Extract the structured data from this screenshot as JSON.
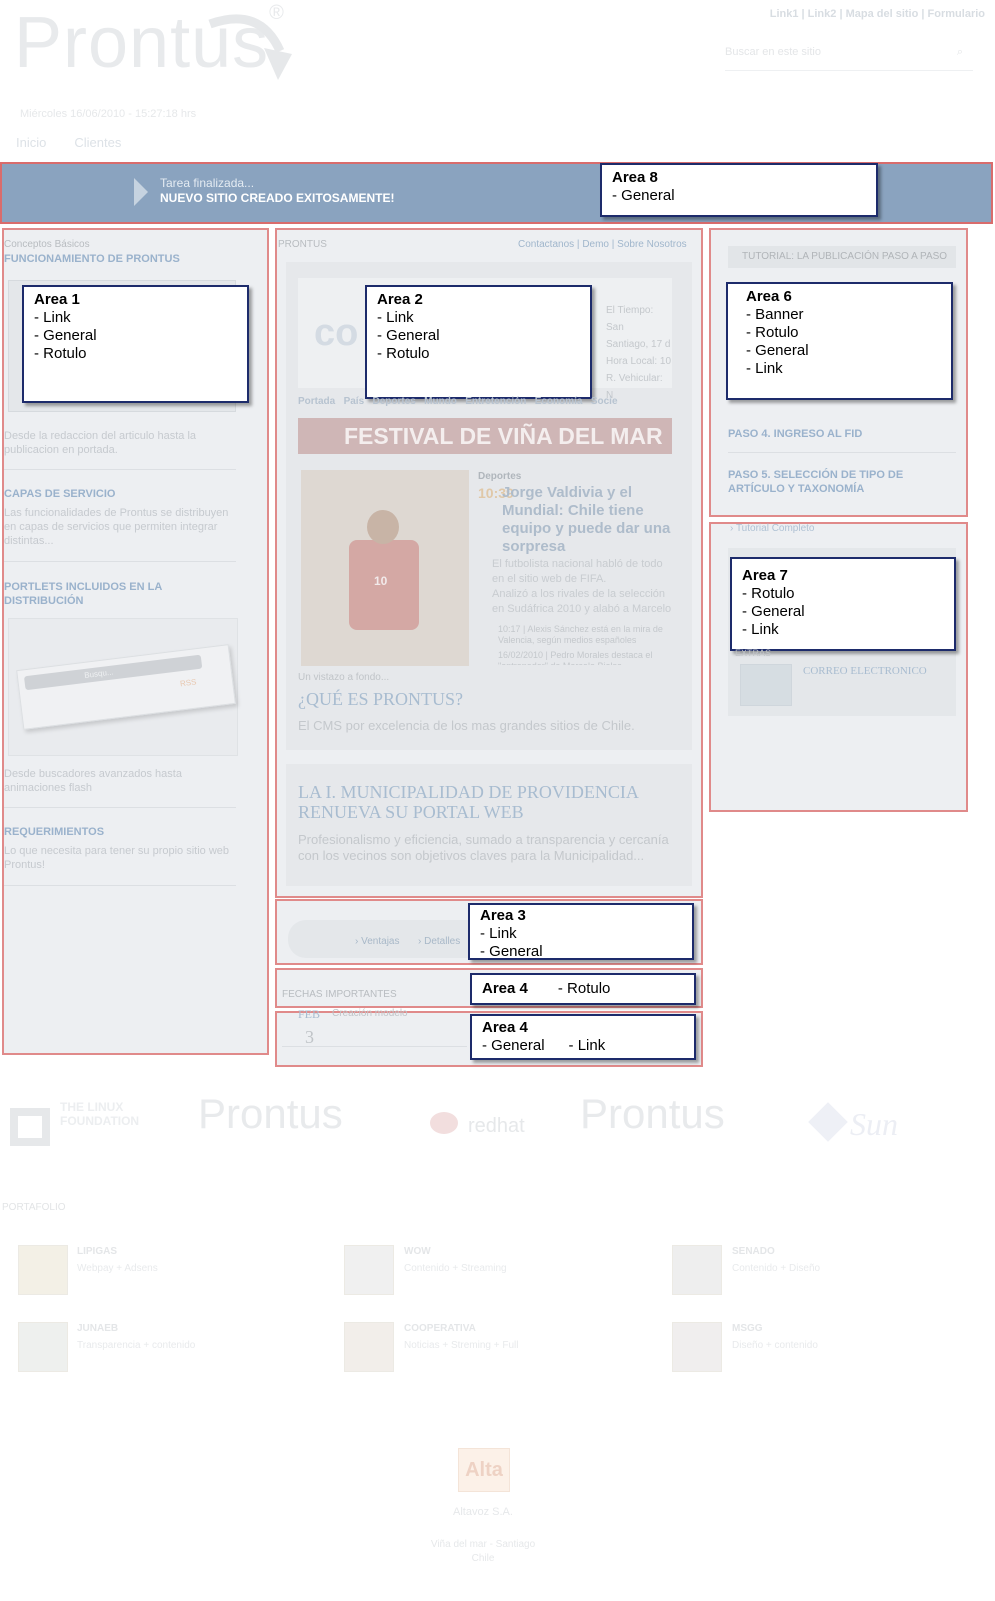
{
  "header": {
    "logo": "Prontus",
    "reg": "®",
    "toplinks": [
      "Link1",
      "Link2",
      "Mapa del sitio",
      "Formulario"
    ],
    "search_placeholder": "Buscar en este sitio",
    "date": "Miércoles 16/06/2010  -  15:27:18 hrs",
    "nav": [
      "Inicio",
      "Clientes"
    ]
  },
  "banner": {
    "line1": "Tarea finalizada...",
    "line2": "NUEVO SITIO CREADO EXITOSAMENTE!"
  },
  "labels": {
    "a8_title": "Area 8",
    "a8_l1": "- General",
    "a1_title": "Area 1",
    "a1_l1": "- Link",
    "a1_l2": "- General",
    "a1_l3": "- Rotulo",
    "a2_title": "Area 2",
    "a2_l1": "- Link",
    "a2_l2": "- General",
    "a2_l3": "- Rotulo",
    "a6_title": "Area 6",
    "a6_l1": "- Banner",
    "a6_l2": "- Rotulo",
    "a6_l3": "- General",
    "a6_l4": "- Link",
    "a7_title": "Area 7",
    "a7_l1": "- Rotulo",
    "a7_l2": "- General",
    "a7_l3": "- Link",
    "a3_title": "Area 3",
    "a3_l1": "- Link",
    "a3_l2": "- General",
    "a4a_title": "Area 4",
    "a4a_l1": "- Rotulo",
    "a4b_title": "Area 4",
    "a4b_l1": "- General",
    "a4b_l2": "- Link"
  },
  "left": {
    "kicker": "Conceptos Básicos",
    "title1": "FUNCIONAMIENTO DE PRONTUS",
    "desc1": "Desde la redaccion del articulo hasta la publicacion en portada.",
    "title2": "CAPAS DE SERVICIO",
    "desc2": "Las funcionalidades de Prontus se distribuyen en capas de servicios que permiten integrar distintas...",
    "title3": "PORTLETS INCLUIDOS EN LA DISTRIBUCIÓN",
    "search_mini": "Busqu...",
    "rss": "RSS",
    "desc3": "Desde buscadores avanzados hasta animaciones flash",
    "title4": "REQUERIMIENTOS",
    "desc4": "Lo que necesita para tener su propio sitio web Prontus!"
  },
  "center": {
    "section": "PRONTUS",
    "links": [
      "Contactanos",
      "Demo",
      "Sobre Nosotros"
    ],
    "weather1": "El Tiempo: San",
    "weather2": "Santiago, 17 d",
    "weather3": "Hora Local: 10",
    "weather4": "R. Vehicular: N",
    "navstrip": "Portada   País   Deportes   Mundo   Entretención   Economía   Socie",
    "festival": "FESTIVAL DE VIÑA DEL MAR",
    "sport": "Deportes",
    "time": "10:39",
    "headline": "Jorge Valdivia y el Mundial: Chile tiene equipo y puede dar una sorpresa",
    "b1": "El futbolista nacional habló de todo en el sitio web de FIFA.",
    "b2": "Analizó a los rivales de la selección en Sudáfrica 2010 y alabó a Marcelo",
    "r1": "10:17 | Alexis Sánchez está en la mira de Valencia, según medios españoles",
    "r2": "16/02/2010 | Pedro Morales destaca el \"entrenador\" de Marcelo Bielsa",
    "jersey": "10",
    "glance": "Un vistazo a fondo...",
    "q_title": "¿QUÉ ES PRONTUS?",
    "q_desc": "El CMS por excelencia de los mas grandes sitios de Chile.",
    "story_title": "LA I. MUNICIPALIDAD DE PROVIDENCIA RENUEVA SU PORTAL WEB",
    "story_desc": "Profesionalismo y eficiencia, sumado a transparencia y cercanía con los vecinos son objetivos claves para la Municipalidad..."
  },
  "tabs": [
    "Ventajas",
    "Detalles"
  ],
  "dates": {
    "title": "FECHAS IMPORTANTES",
    "month": "FEB",
    "day": "3",
    "event": "Creación modelo"
  },
  "right": {
    "tutorial": "TUTORIAL: LA PUBLICACIÓN PASO A PASO",
    "step4": "PASO 4. INGRESO AL FID",
    "step5": "PASO 5. SELECCIÓN DE TIPO DE ARTÍCULO Y TAXONOMÍA",
    "full": "Tutorial Completo",
    "extras": "EXTRAS",
    "mail": "CORREO ELECTRONICO"
  },
  "partners": [
    "THE LINUX FOUNDATION",
    "Prontus",
    "redhat",
    "Prontus",
    "Sun"
  ],
  "portfolio": {
    "title": "PORTAFOLIO",
    "items": [
      {
        "name": "LIPIGAS",
        "desc": "Webpay + Adsens"
      },
      {
        "name": "WOW",
        "desc": "Contenido + Streaming"
      },
      {
        "name": "SENADO",
        "desc": "Contenido + Diseño"
      },
      {
        "name": "JUNAEB",
        "desc": "Transparencia + contenido"
      },
      {
        "name": "COOPERATIVA",
        "desc": "Noticias + Streming + Full"
      },
      {
        "name": "MSGG",
        "desc": "Diseño + contenido"
      }
    ]
  },
  "footer": {
    "logo": "Alta",
    "company": "Altavoz S.A.",
    "city": "Viña del mar - Santiago",
    "country": "Chile"
  }
}
